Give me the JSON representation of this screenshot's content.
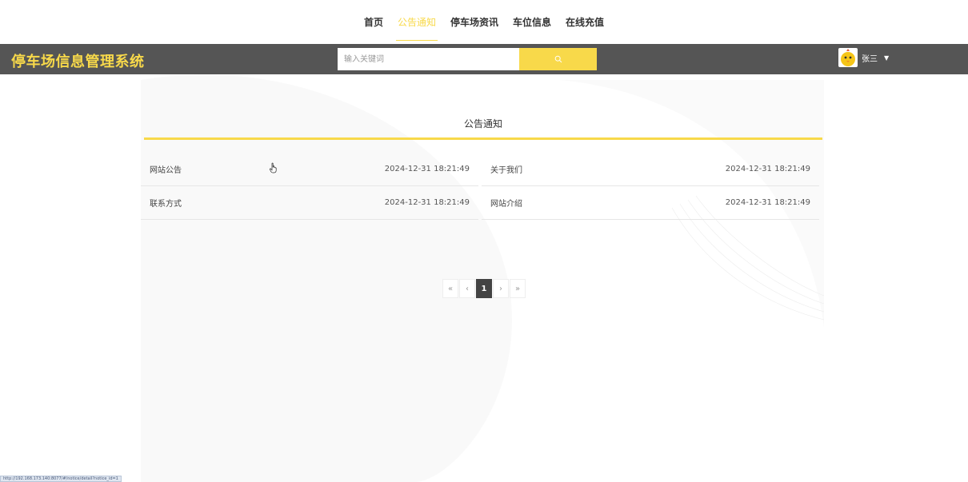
{
  "nav": {
    "items": [
      {
        "label": "首页"
      },
      {
        "label": "公告通知"
      },
      {
        "label": "停车场资讯"
      },
      {
        "label": "车位信息"
      },
      {
        "label": "在线充值"
      }
    ],
    "active_index": 1
  },
  "header": {
    "logo": "停车场信息管理系统",
    "search_placeholder": "输入关键词",
    "username": "张三"
  },
  "main": {
    "title": "公告通知",
    "notices": [
      {
        "title": "网站公告",
        "date": "2024-12-31 18:21:49"
      },
      {
        "title": "关于我们",
        "date": "2024-12-31 18:21:49"
      },
      {
        "title": "联系方式",
        "date": "2024-12-31 18:21:49"
      },
      {
        "title": "网站介绍",
        "date": "2024-12-31 18:21:49"
      }
    ]
  },
  "pagination": {
    "first": "«",
    "prev": "‹",
    "current": "1",
    "next": "›",
    "last": "»"
  },
  "status_url": "http://192.168.173.140:8077/#/notice/detail?notice_id=1",
  "colors": {
    "accent": "#f8d94a",
    "header_bg": "#555555"
  }
}
